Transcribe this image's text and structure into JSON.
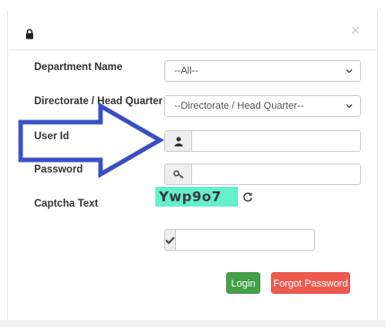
{
  "header": {
    "close_symbol": "×"
  },
  "form": {
    "department": {
      "label": "Department Name",
      "selected": "--All--"
    },
    "directorate": {
      "label": "Directorate / Head Quarter",
      "selected": "--Directorate / Head Quarter--"
    },
    "user_id": {
      "label": "User Id",
      "value": ""
    },
    "password": {
      "label": "Password",
      "value": ""
    },
    "captcha": {
      "label": "Captcha Text",
      "code": "Ywp9o7",
      "answer": ""
    }
  },
  "buttons": {
    "login": "Login",
    "forgot_password": "Forgot Password"
  },
  "colors": {
    "captcha_bg": "#64f0c8",
    "login_bg": "#43a047",
    "forgot_bg": "#ef5a50",
    "arrow_stroke": "#3a4fc2"
  },
  "icons": [
    "lock-icon",
    "close-icon",
    "chevron-down-icon",
    "user-icon",
    "key-icon",
    "refresh-icon",
    "checkmark-icon",
    "arrow-pointer"
  ]
}
